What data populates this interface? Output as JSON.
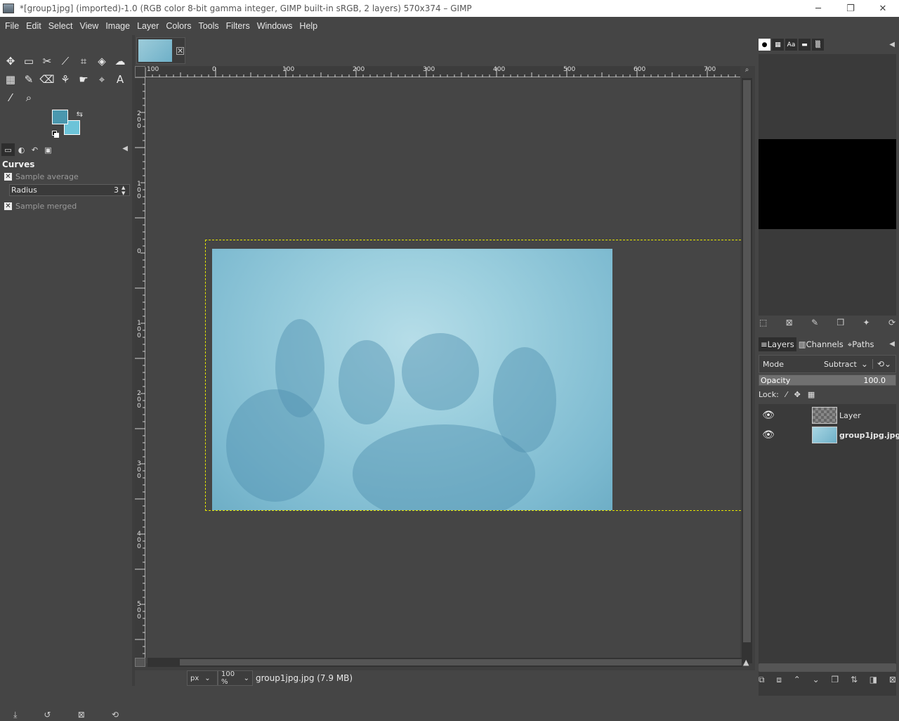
{
  "window": {
    "title": "*[group1jpg] (imported)-1.0 (RGB color 8-bit gamma integer, GIMP built-in sRGB, 2 layers) 570x374 – GIMP",
    "minimize": "─",
    "maximize": "❐",
    "close": "✕"
  },
  "menu": [
    "File",
    "Edit",
    "Select",
    "View",
    "Image",
    "Layer",
    "Colors",
    "Tools",
    "Filters",
    "Windows",
    "Help"
  ],
  "colors": {
    "foreground": "#4a97ae",
    "background": "#6cc3d8",
    "selection": "#e6e600"
  },
  "tool_options": {
    "title": "Curves",
    "sample_average": {
      "label": "Sample average",
      "checked": true
    },
    "radius": {
      "label": "Radius",
      "value": "3"
    },
    "sample_merged": {
      "label": "Sample merged",
      "checked": true
    }
  },
  "ruler": {
    "h_labels": [
      "100",
      "0",
      "100",
      "200",
      "300",
      "400",
      "500",
      "600",
      "700"
    ],
    "v_labels": [
      "2\n0\n0",
      "1\n0\n0",
      "0",
      "1\n0\n0",
      "2\n0\n0",
      "3\n0\n0",
      "4\n0\n0",
      "5\n0\n0"
    ]
  },
  "status": {
    "unit": "px",
    "zoom": "100 %",
    "text": "group1jpg.jpg (7.9 MB)"
  },
  "layers_panel": {
    "tabs": [
      "Layers",
      "Channels",
      "Paths"
    ],
    "mode_label": "Mode",
    "mode_value": "Subtract",
    "opacity_label": "Opacity",
    "opacity_value": "100.0",
    "lock_label": "Lock:",
    "layers": [
      {
        "name": "Layer",
        "visible": true,
        "bold": false
      },
      {
        "name": "group1jpg.jpg",
        "visible": true,
        "bold": true
      }
    ]
  }
}
